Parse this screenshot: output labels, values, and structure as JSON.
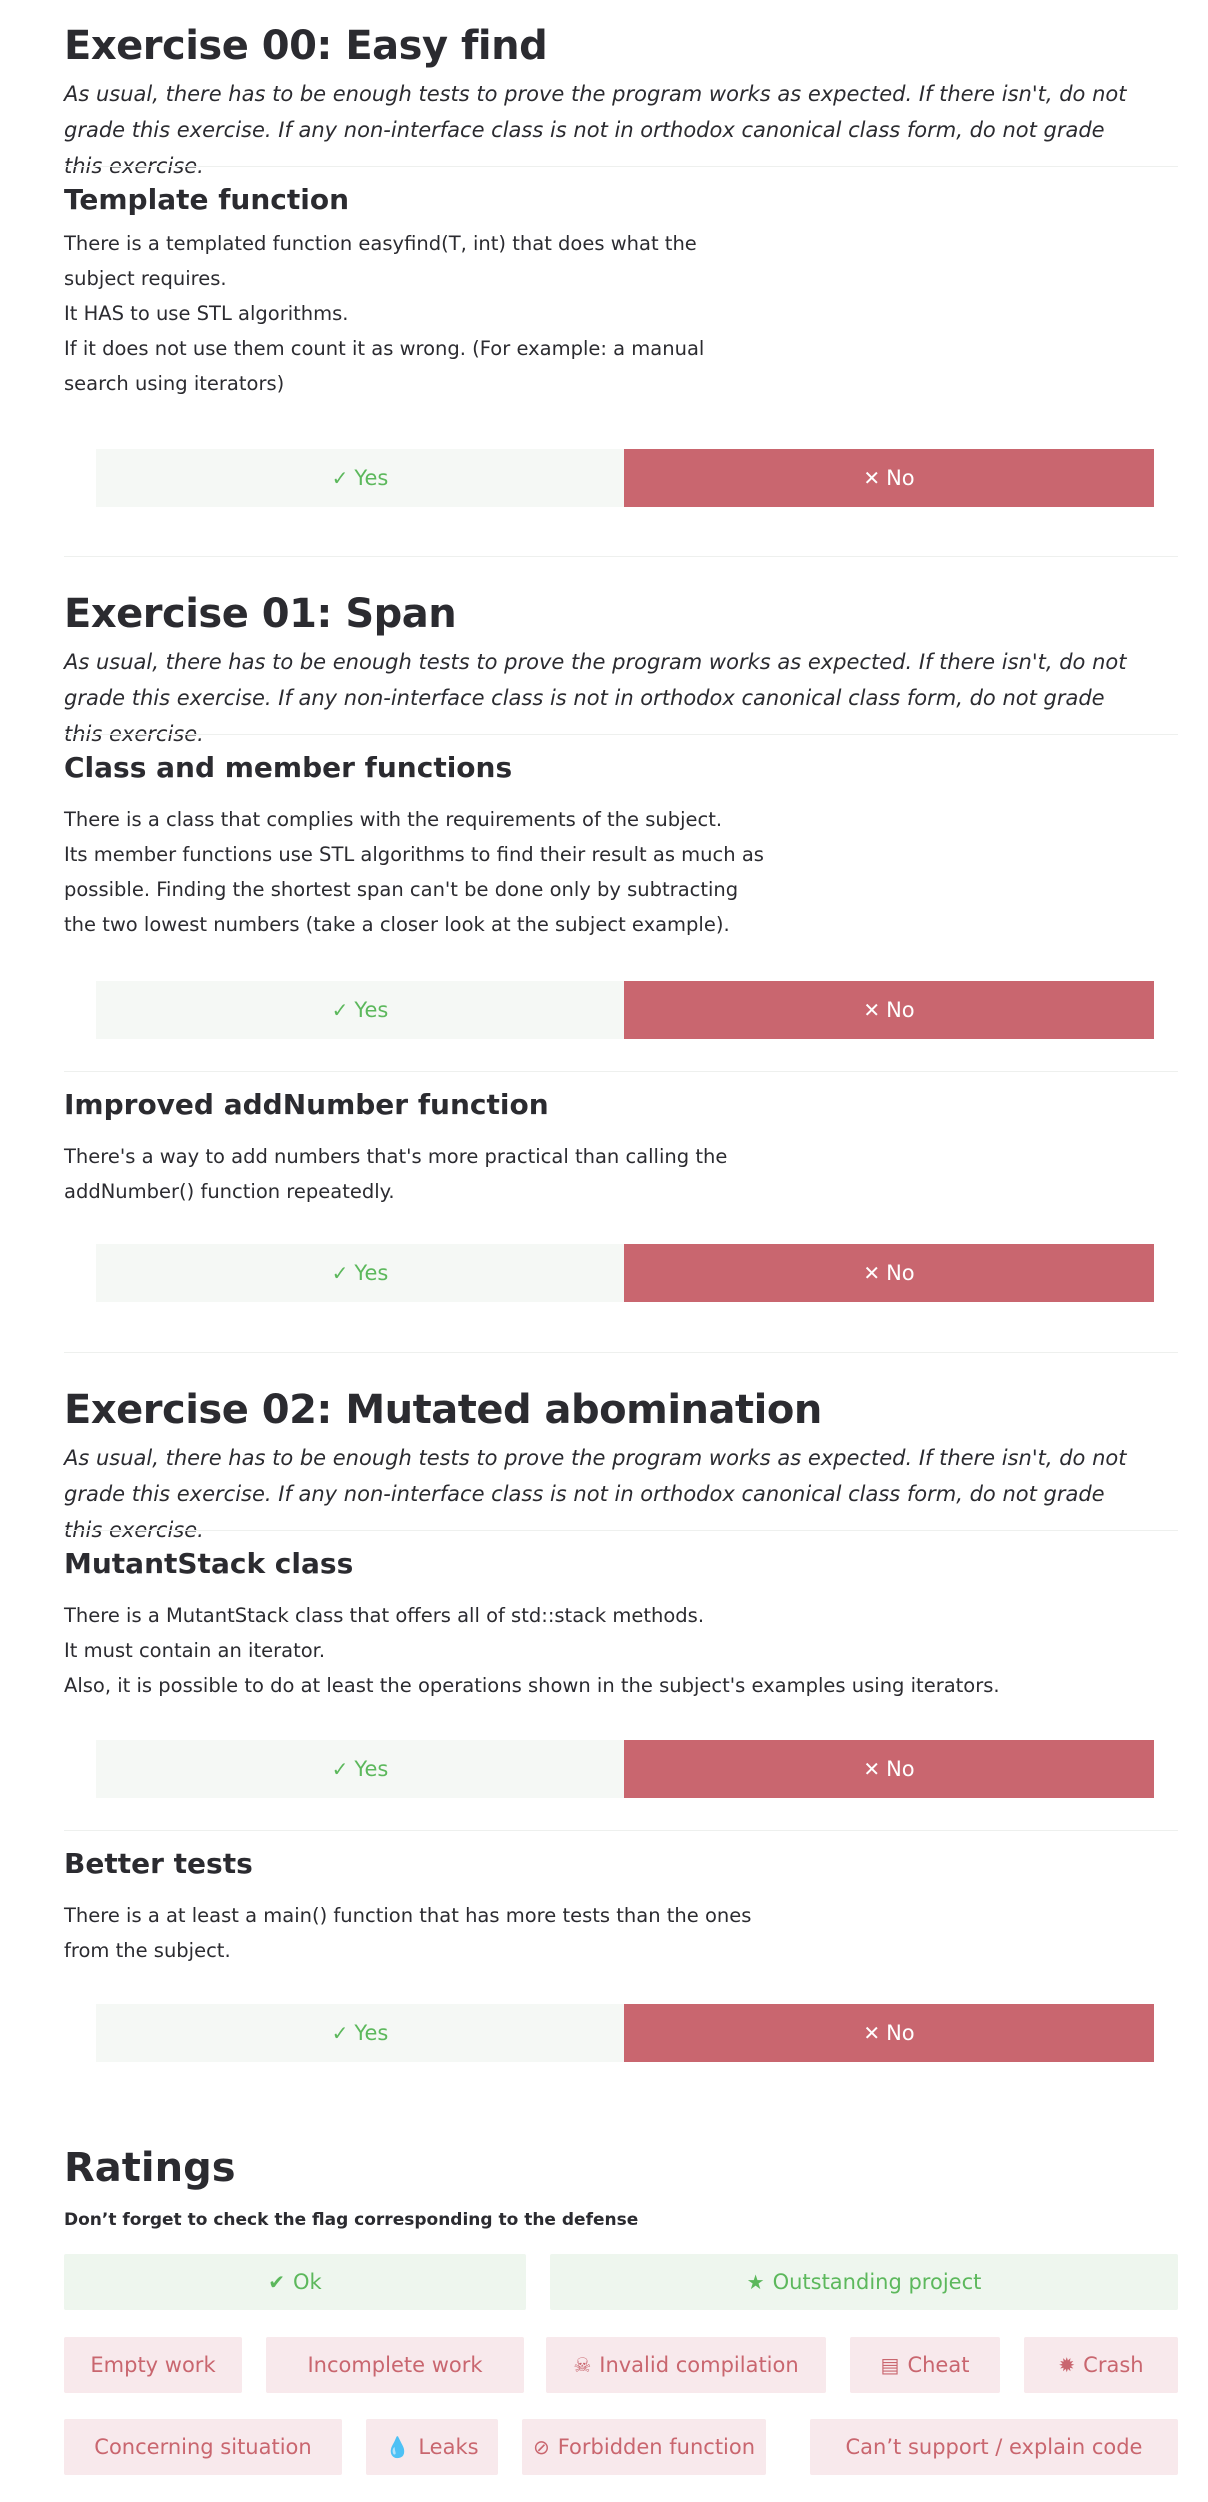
{
  "exercises": [
    {
      "title": "Exercise 00: Easy find",
      "note": "As usual, there has to be enough tests to prove the program works as expected. If there isn't, do not grade this exercise. If any non-interface class is not in orthodox canonical class form, do not grade this exercise.",
      "questions": [
        {
          "title": "Template function",
          "description": "There is a templated function easyfind(T, int) that does what the\nsubject requires.\nIt HAS to use STL algorithms.\nIf it does not use them count it as wrong. (For example: a manual\nsearch using iterators)"
        }
      ]
    },
    {
      "title": "Exercise 01: Span",
      "note": "As usual, there has to be enough tests to prove the program works as expected. If there isn't, do not grade this exercise. If any non-interface class is not in orthodox canonical class form, do not grade this exercise.",
      "questions": [
        {
          "title": "Class and member functions",
          "description": "There is a class that complies with the requirements of the subject.\nIts member functions use STL algorithms to find their result as much as\npossible. Finding the shortest span can't be done only by subtracting\nthe two lowest numbers (take a closer look at the subject example)."
        },
        {
          "title": "Improved addNumber function",
          "description": "There's a way to add numbers that's more practical than calling the\naddNumber() function repeatedly."
        }
      ]
    },
    {
      "title": "Exercise 02: Mutated abomination",
      "note": "As usual, there has to be enough tests to prove the program works as expected. If there isn't, do not grade this exercise. If any non-interface class is not in orthodox canonical class form, do not grade this exercise.",
      "questions": [
        {
          "title": "MutantStack class",
          "description": "There is a MutantStack class that offers all of std::stack methods.\nIt must contain an iterator.\nAlso, it is possible to do at least the operations shown in the subject's examples using iterators."
        },
        {
          "title": "Better tests",
          "description": "There is a at least a main() function that has more tests than the ones\nfrom the subject."
        }
      ]
    }
  ],
  "buttons": {
    "yes": "Yes",
    "no": "No"
  },
  "ratings": {
    "title": "Ratings",
    "subtitle": "Don’t forget to check the flag corresponding to the defense",
    "flags": [
      {
        "label": "Ok",
        "icon": "check-icon"
      },
      {
        "label": "Outstanding project",
        "icon": "star-icon"
      },
      {
        "label": "Empty work",
        "icon": ""
      },
      {
        "label": "Incomplete work",
        "icon": ""
      },
      {
        "label": "Invalid compilation",
        "icon": "skull-icon"
      },
      {
        "label": "Cheat",
        "icon": "cards-icon"
      },
      {
        "label": "Crash",
        "icon": "explosion-icon"
      },
      {
        "label": "Concerning situation",
        "icon": ""
      },
      {
        "label": "Leaks",
        "icon": "drop-icon"
      },
      {
        "label": "Forbidden function",
        "icon": "forbidden-icon"
      },
      {
        "label": "Can’t support / explain code",
        "icon": ""
      }
    ]
  },
  "colors": {
    "text": "#2b2b30",
    "yes": "#5cb85c",
    "yes_bg": "#f5f8f5",
    "no_bg": "#c9666f",
    "positive_bg": "#eef6ee",
    "negative_bg": "#f8e9ec"
  }
}
